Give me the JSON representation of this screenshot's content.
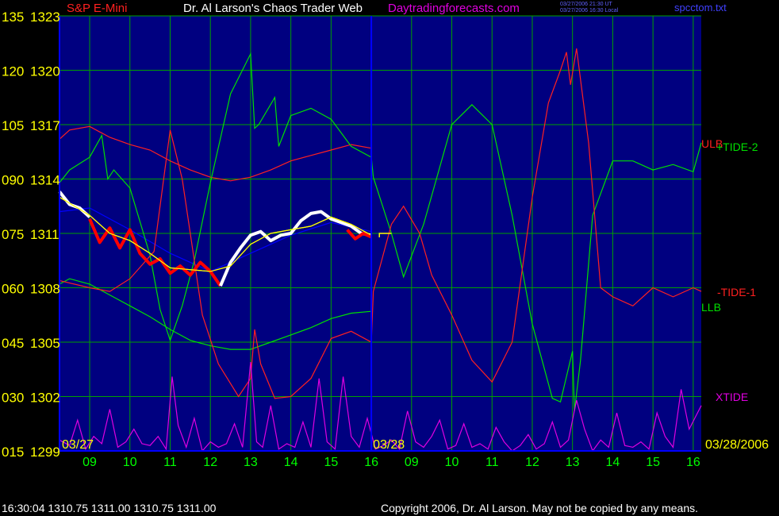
{
  "header": {
    "symbol": "S&P E-Mini",
    "title": "Dr. Al Larson's Chaos Trader Web",
    "site": "Daytradingforecasts.com",
    "stamp_ut": "03/27/2006 21:30 UT",
    "stamp_local": "03/27/2006 16:30 Local",
    "file": "spcctom.txt"
  },
  "footer": {
    "quote": "16:30:04  1310.75 1311.00 1310.75 1311.00",
    "copyright": "Copyright 2006, Dr. Al Larson. May not be copied by any means."
  },
  "colors": {
    "background": "#000080",
    "grid": "#00a000",
    "axis": "#0000ff",
    "price_up": "#ffffff",
    "price_down": "#ff0000",
    "ma_fast": "#ffff00",
    "ma_slow": "#0000ff",
    "ulb": "#ff2020",
    "llb": "#00e000",
    "tide2": "#00e000",
    "tide1": "#ff2020",
    "xtide": "#e000e0"
  },
  "chart_data": {
    "type": "line",
    "yaxis": {
      "left_index": [
        "135",
        "120",
        "105",
        "090",
        "075",
        "060",
        "045",
        "030",
        "015"
      ],
      "prices": [
        "1323",
        "1320",
        "1317",
        "1314",
        "1311",
        "1308",
        "1305",
        "1302",
        "1299"
      ],
      "ylim": [
        1299,
        1323
      ]
    },
    "xaxis": {
      "ticks": [
        "09",
        "10",
        "11",
        "12",
        "13",
        "14",
        "15",
        "16",
        "09",
        "10",
        "11",
        "12",
        "13",
        "14",
        "15",
        "16"
      ],
      "date_labels": [
        "03/27",
        "03/28",
        "03/28/2006"
      ]
    },
    "legend": [
      {
        "name": "ULB",
        "color": "#ff2020"
      },
      {
        "name": "+TIDE-2",
        "color": "#00e000"
      },
      {
        "name": "-TIDE-1",
        "color": "#ff2020"
      },
      {
        "name": "LLB",
        "color": "#00e000"
      },
      {
        "name": "XTIDE",
        "color": "#e000e0"
      }
    ],
    "price_segments": [
      {
        "x": [
          8.25,
          8.5,
          8.75,
          9.0
        ],
        "y": [
          1313.3,
          1312.6,
          1312.4,
          1311.9
        ],
        "color": "up"
      },
      {
        "x": [
          9.0,
          9.25,
          9.5,
          9.75,
          10.0,
          10.25,
          10.5,
          10.75,
          11.0,
          11.25,
          11.5,
          11.75,
          12.0,
          12.25
        ],
        "y": [
          1311.8,
          1310.5,
          1311.3,
          1310.2,
          1311.2,
          1309.9,
          1309.3,
          1309.6,
          1308.8,
          1309.2,
          1308.7,
          1309.4,
          1308.9,
          1308.1
        ],
        "color": "down"
      },
      {
        "x": [
          12.25,
          12.5,
          12.75,
          13.0,
          13.25,
          13.5,
          13.75,
          14.0,
          14.25,
          14.5,
          14.75,
          15.0,
          15.25,
          15.5,
          15.75,
          16.0
        ],
        "y": [
          1308.1,
          1309.4,
          1310.2,
          1310.9,
          1311.1,
          1310.6,
          1310.9,
          1311.0,
          1311.7,
          1312.1,
          1312.2,
          1311.8,
          1311.6,
          1311.4,
          1311.0,
          1310.9
        ],
        "color": "up"
      },
      {
        "x": [
          15.4,
          15.6,
          15.8,
          16.0
        ],
        "y": [
          1311.2,
          1310.7,
          1311.0,
          1310.8
        ],
        "color": "down"
      }
    ],
    "projection": {
      "x": [
        16.2,
        16.5
      ],
      "y": [
        1311.0,
        1311.0
      ]
    },
    "series": [
      {
        "name": "ma-fast",
        "color": "#ffff00",
        "x": [
          8.25,
          9.0,
          9.5,
          10.0,
          10.5,
          11.0,
          11.5,
          12.0,
          12.5,
          13.0,
          13.5,
          14.0,
          14.5,
          15.0,
          15.5,
          16.0
        ],
        "y": [
          1313.0,
          1312.0,
          1311.0,
          1310.6,
          1309.9,
          1309.1,
          1309.0,
          1308.9,
          1309.2,
          1310.4,
          1311.0,
          1311.2,
          1311.4,
          1311.9,
          1311.5,
          1310.9
        ]
      },
      {
        "name": "ma-slow",
        "color": "#0000ff",
        "x": [
          8.25,
          9.0,
          10.0,
          11.0,
          12.0,
          13.0,
          14.0,
          15.0,
          16.0
        ],
        "y": [
          1312.2,
          1312.4,
          1311.2,
          1309.9,
          1308.9,
          1309.9,
          1310.9,
          1311.6,
          1311.1
        ]
      },
      {
        "name": "ULB",
        "color": "#ff2020",
        "x": [
          8.25,
          8.5,
          9.0,
          9.5,
          10.0,
          10.5,
          11.0,
          11.5,
          12.0,
          12.5,
          13.0,
          13.5,
          14.0,
          14.5,
          15.0,
          15.5,
          16.0
        ],
        "y": [
          1316.2,
          1316.7,
          1316.9,
          1316.3,
          1315.9,
          1315.6,
          1315.0,
          1314.5,
          1314.1,
          1313.9,
          1314.1,
          1314.5,
          1315.0,
          1315.3,
          1315.6,
          1315.9,
          1315.7
        ]
      },
      {
        "name": "LLB",
        "color": "#00e000",
        "x": [
          8.25,
          8.5,
          9.0,
          9.5,
          10.0,
          10.5,
          11.0,
          11.5,
          12.0,
          12.5,
          13.0,
          13.5,
          14.0,
          14.5,
          15.0,
          15.5,
          16.0
        ],
        "y": [
          1308.2,
          1308.5,
          1308.2,
          1307.6,
          1307.0,
          1306.4,
          1305.7,
          1305.1,
          1304.8,
          1304.6,
          1304.6,
          1305.0,
          1305.4,
          1305.8,
          1306.3,
          1306.6,
          1306.7
        ]
      },
      {
        "name": "+TIDE-2",
        "color": "#00e000",
        "x": [
          8.25,
          8.5,
          9.0,
          9.3,
          9.45,
          9.6,
          10.0,
          10.5,
          10.75,
          11.0,
          11.3,
          11.6,
          12.0,
          12.5,
          13.0,
          13.1,
          13.2,
          13.6,
          13.7,
          14.0,
          14.5,
          15.0,
          15.5,
          16.0,
          16.05,
          16.5,
          16.8,
          17.3,
          18.0,
          18.5,
          19.0,
          19.5,
          20.0,
          20.5,
          20.7,
          21.0,
          21.05,
          21.2,
          21.5,
          22.0,
          22.5,
          23.0,
          23.5,
          24.0,
          24.2
        ],
        "y": [
          1313.8,
          1314.5,
          1315.2,
          1316.4,
          1314.0,
          1314.5,
          1313.5,
          1309.8,
          1306.8,
          1305.1,
          1307.0,
          1309.5,
          1313.8,
          1318.7,
          1320.9,
          1316.8,
          1317.0,
          1318.5,
          1315.8,
          1317.5,
          1317.9,
          1317.3,
          1315.8,
          1315.2,
          1314.1,
          1311.0,
          1308.6,
          1311.5,
          1317.0,
          1318.1,
          1317.0,
          1312.0,
          1306.0,
          1301.9,
          1301.7,
          1304.5,
          1301.2,
          1304.0,
          1312.0,
          1315.0,
          1315.0,
          1314.5,
          1314.8,
          1314.4,
          1316.0
        ]
      },
      {
        "name": "-TIDE-1",
        "color": "#ff2020",
        "x": [
          8.25,
          9.0,
          9.5,
          10.0,
          10.6,
          11.0,
          11.3,
          11.8,
          12.2,
          12.7,
          13.0,
          13.1,
          13.25,
          13.6,
          14.0,
          14.5,
          15.0,
          15.5,
          16.0,
          16.05,
          16.5,
          16.8,
          17.2,
          17.5,
          18.0,
          18.5,
          19.0,
          19.5,
          20.0,
          20.4,
          20.7,
          20.85,
          20.95,
          21.1,
          21.4,
          21.7,
          22.0,
          22.5,
          23.0,
          23.5,
          24.0,
          24.2
        ],
        "y": [
          1308.4,
          1308.0,
          1307.8,
          1308.5,
          1310.0,
          1316.7,
          1314.0,
          1306.5,
          1303.8,
          1302.0,
          1303.0,
          1305.7,
          1303.8,
          1301.9,
          1302.0,
          1303.0,
          1305.2,
          1305.6,
          1305.0,
          1307.8,
          1311.5,
          1312.5,
          1311.0,
          1308.7,
          1306.5,
          1304.0,
          1302.8,
          1305.0,
          1313.0,
          1318.2,
          1320.0,
          1321.0,
          1319.2,
          1321.2,
          1316.0,
          1308.0,
          1307.5,
          1307.0,
          1308.0,
          1307.5,
          1308.0,
          1307.8
        ]
      },
      {
        "name": "XTIDE",
        "color": "#e000e0",
        "x": [
          8.25,
          8.5,
          8.7,
          8.9,
          9.1,
          9.3,
          9.5,
          9.7,
          9.9,
          10.1,
          10.3,
          10.5,
          10.7,
          10.9,
          11.05,
          11.2,
          11.4,
          11.6,
          11.8,
          12.0,
          12.2,
          12.4,
          12.6,
          12.8,
          13.0,
          13.15,
          13.3,
          13.5,
          13.7,
          13.9,
          14.1,
          14.3,
          14.5,
          14.7,
          14.9,
          15.1,
          15.3,
          15.5,
          15.7,
          15.9,
          16.1,
          16.3,
          16.5,
          16.7,
          16.9,
          17.1,
          17.3,
          17.5,
          17.7,
          17.9,
          18.1,
          18.3,
          18.5,
          18.7,
          18.9,
          19.1,
          19.3,
          19.5,
          19.7,
          19.9,
          20.1,
          20.3,
          20.5,
          20.7,
          20.9,
          21.1,
          21.3,
          21.5,
          21.7,
          21.9,
          22.1,
          22.3,
          22.5,
          22.7,
          22.9,
          23.1,
          23.3,
          23.5,
          23.7,
          23.9,
          24.2
        ],
        "y": [
          1299.6,
          1299.3,
          1300.7,
          1299.1,
          1299.8,
          1299.4,
          1301.3,
          1299.2,
          1299.5,
          1300.2,
          1299.4,
          1299.3,
          1299.8,
          1299.1,
          1303.1,
          1300.4,
          1299.2,
          1300.8,
          1299.0,
          1299.5,
          1299.2,
          1299.4,
          1300.5,
          1299.2,
          1303.9,
          1299.5,
          1299.2,
          1301.5,
          1299.1,
          1299.4,
          1299.2,
          1300.6,
          1299.2,
          1303.0,
          1299.5,
          1299.1,
          1303.1,
          1299.8,
          1299.2,
          1300.8,
          1299.1,
          1299.3,
          1299.6,
          1299.1,
          1301.2,
          1299.5,
          1299.2,
          1299.8,
          1300.7,
          1299.1,
          1299.3,
          1300.5,
          1299.2,
          1299.4,
          1299.1,
          1300.3,
          1299.5,
          1299.0,
          1299.3,
          1299.9,
          1299.1,
          1299.4,
          1300.6,
          1299.2,
          1299.6,
          1301.8,
          1300.2,
          1299.0,
          1299.6,
          1299.2,
          1301.1,
          1299.3,
          1299.2,
          1299.5,
          1299.1,
          1301.1,
          1299.8,
          1299.2,
          1302.4,
          1300.2,
          1301.5
        ]
      }
    ]
  }
}
